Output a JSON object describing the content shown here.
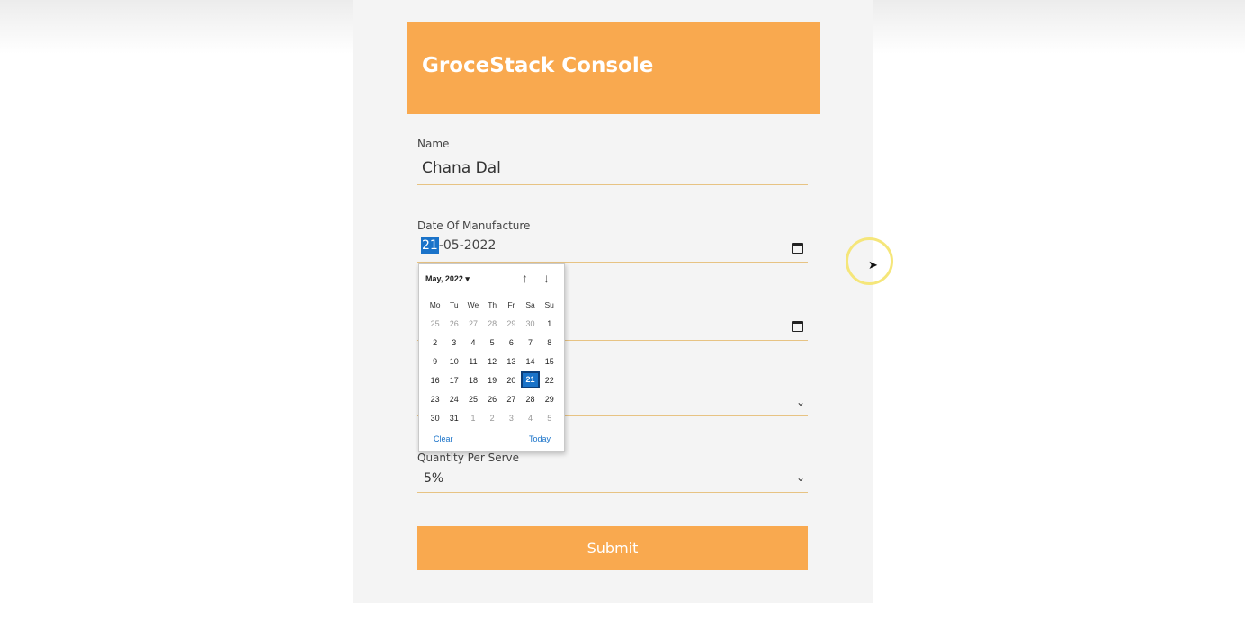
{
  "header": {
    "title": "GroceStack Console"
  },
  "form": {
    "name": {
      "label": "Name",
      "value": "Chana Dal"
    },
    "date_of_manufacture": {
      "label": "Date Of Manufacture",
      "day": "21",
      "rest": "-05-2022"
    },
    "quantity_per_serve": {
      "label": "Quantity Per Serve",
      "value": "5%"
    },
    "submit_label": "Submit"
  },
  "calendar": {
    "month_label": "May, 2022 ▾",
    "weekdays": [
      "Mo",
      "Tu",
      "We",
      "Th",
      "Fr",
      "Sa",
      "Su"
    ],
    "weeks": [
      [
        "25",
        "26",
        "27",
        "28",
        "29",
        "30",
        "1"
      ],
      [
        "2",
        "3",
        "4",
        "5",
        "6",
        "7",
        "8"
      ],
      [
        "9",
        "10",
        "11",
        "12",
        "13",
        "14",
        "15"
      ],
      [
        "16",
        "17",
        "18",
        "19",
        "20",
        "21",
        "22"
      ],
      [
        "23",
        "24",
        "25",
        "26",
        "27",
        "28",
        "29"
      ],
      [
        "30",
        "31",
        "1",
        "2",
        "3",
        "4",
        "5"
      ]
    ],
    "selected": "21",
    "clear_label": "Clear",
    "today_label": "Today"
  },
  "colors": {
    "accent": "#f9a94f",
    "selection": "#1a73c9"
  }
}
